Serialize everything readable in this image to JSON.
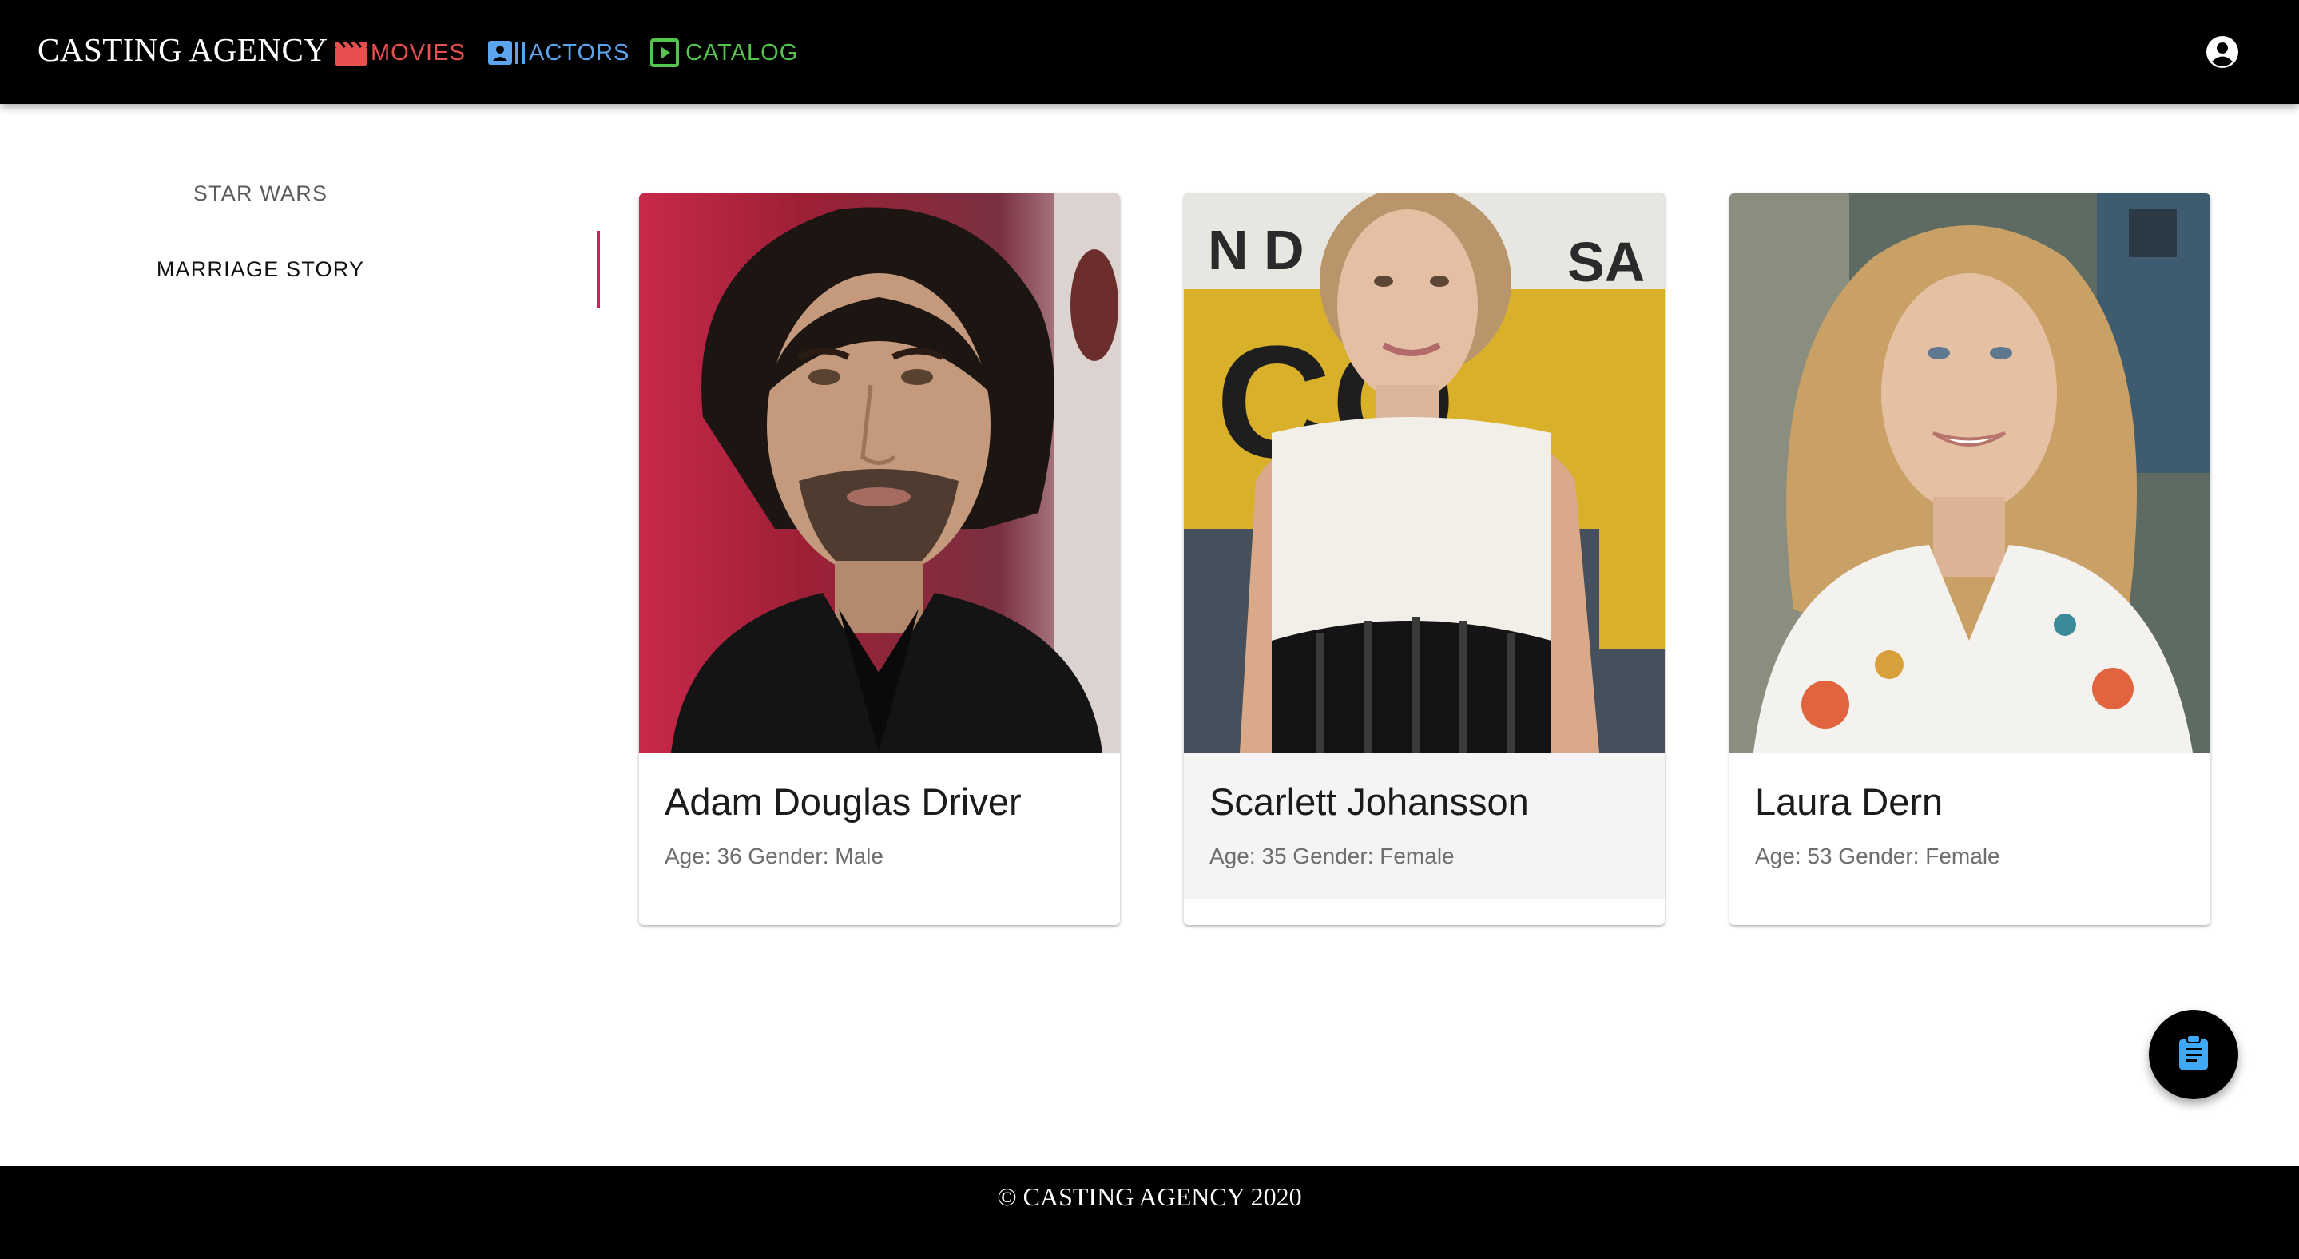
{
  "app": {
    "title": "CASTING AGENCY"
  },
  "nav": {
    "links": [
      {
        "label": "MOVIES",
        "icon": "clapperboard-icon",
        "color": "#e8504f"
      },
      {
        "label": "ACTORS",
        "icon": "contact-card-icon",
        "color": "#5aa5ee"
      },
      {
        "label": "CATALOG",
        "icon": "play-box-icon",
        "color": "#55c44e"
      }
    ],
    "account_icon": "account-circle-icon"
  },
  "sidebar": {
    "items": [
      {
        "label": "STAR WARS",
        "active": false
      },
      {
        "label": "MARRIAGE STORY",
        "active": true
      }
    ],
    "indicator_color": "#e0195a"
  },
  "actors": [
    {
      "name": "Adam Douglas Driver",
      "meta": "Age: 36 Gender: Male"
    },
    {
      "name": "Scarlett Johansson",
      "meta": "Age: 35 Gender: Female"
    },
    {
      "name": "Laura Dern",
      "meta": "Age: 53 Gender: Female"
    }
  ],
  "fab": {
    "icon": "clipboard-icon",
    "icon_color": "#3fa9f5"
  },
  "footer": {
    "text": "© CASTING AGENCY 2020"
  }
}
